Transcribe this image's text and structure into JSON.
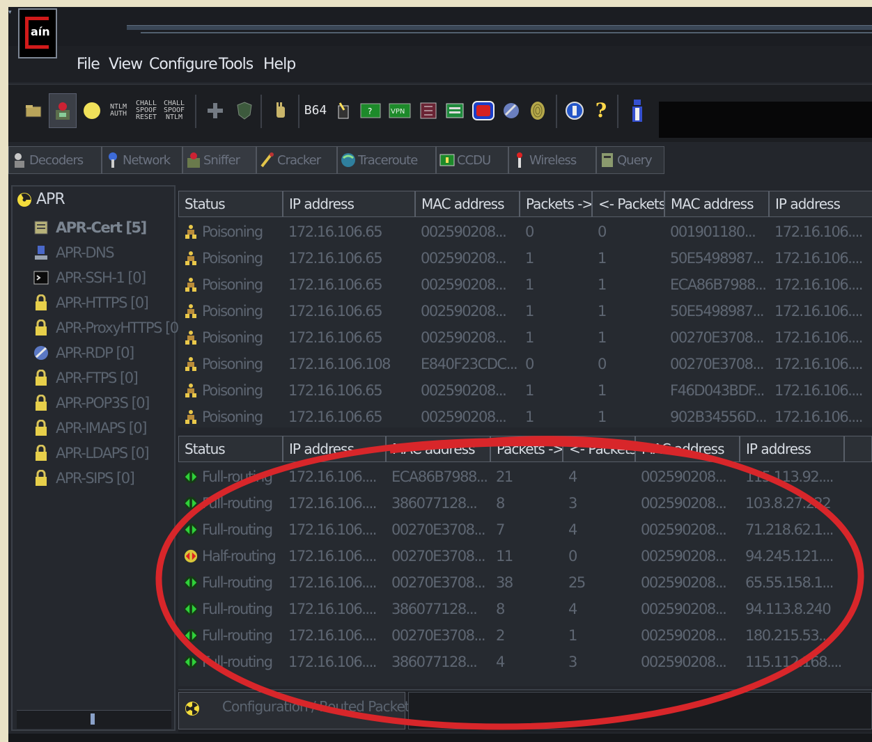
{
  "app": {
    "logo_text": "aín",
    "accent_red": "#d11a1a"
  },
  "menu": [
    "File",
    "View",
    "Configure",
    "Tools",
    "Help"
  ],
  "toolbar": {
    "buttons": [
      {
        "icon": "folder-icon"
      },
      {
        "icon": "sniffer-icon",
        "pressed": true
      },
      {
        "icon": "apr-radiation-icon"
      },
      {
        "icon": "ntlm-auth-icon",
        "label": "NTLM AUTH"
      },
      {
        "icon": "chall-spoof-reset-icon",
        "label": "CHALL SPOOF RESET"
      },
      {
        "icon": "chall-spoof-ntlm-icon",
        "label": "CHALL SPOOF NTLM"
      },
      {
        "icon": "plus-icon"
      },
      {
        "icon": "shield-icon"
      },
      {
        "icon": "hand-icon"
      },
      {
        "icon": "base64-icon",
        "label": "B64"
      },
      {
        "icon": "wand-icon"
      },
      {
        "icon": "terminal-icon"
      },
      {
        "icon": "vpn-icon",
        "label": "VPN"
      },
      {
        "icon": "grid-icon"
      },
      {
        "icon": "screen-icon"
      },
      {
        "icon": "tv-icon"
      },
      {
        "icon": "satellite-icon"
      },
      {
        "icon": "fingerprint-icon"
      },
      {
        "icon": "globe-icon"
      },
      {
        "icon": "help-question-icon",
        "label": "?"
      },
      {
        "icon": "info-icon"
      }
    ]
  },
  "tabs": [
    "Decoders",
    "Network",
    "Sniffer",
    "Cracker",
    "Traceroute",
    "CCDU",
    "Wireless",
    "Query"
  ],
  "sidebar": {
    "root": "APR",
    "items": [
      {
        "label": "APR-Cert [5]",
        "icon": "cert-icon",
        "bold": true
      },
      {
        "label": "APR-DNS",
        "icon": "dns-icon"
      },
      {
        "label": "APR-SSH-1 [0]",
        "icon": "ssh-icon"
      },
      {
        "label": "APR-HTTPS [0]",
        "icon": "lock-icon"
      },
      {
        "label": "APR-ProxyHTTPS [0",
        "icon": "lock-icon"
      },
      {
        "label": "APR-RDP [0]",
        "icon": "rdp-icon"
      },
      {
        "label": "APR-FTPS [0]",
        "icon": "lock-icon"
      },
      {
        "label": "APR-POP3S [0]",
        "icon": "lock-icon"
      },
      {
        "label": "APR-IMAPS [0]",
        "icon": "lock-icon"
      },
      {
        "label": "APR-LDAPS [0]",
        "icon": "lock-icon"
      },
      {
        "label": "APR-SIPS [0]",
        "icon": "lock-icon"
      }
    ]
  },
  "top_table": {
    "headers": [
      "Status",
      "IP address",
      "MAC address",
      "Packets ->",
      "<- Packets",
      "MAC address",
      "IP address"
    ],
    "rows": [
      [
        "Poisoning",
        "172.16.106.65",
        "002590208...",
        "0",
        "0",
        "001901180...",
        "172.16.106...."
      ],
      [
        "Poisoning",
        "172.16.106.65",
        "002590208...",
        "1",
        "1",
        "50E5498987...",
        "172.16.106...."
      ],
      [
        "Poisoning",
        "172.16.106.65",
        "002590208...",
        "1",
        "1",
        "ECA86B7988...",
        "172.16.106...."
      ],
      [
        "Poisoning",
        "172.16.106.65",
        "002590208...",
        "1",
        "1",
        "50E5498987...",
        "172.16.106...."
      ],
      [
        "Poisoning",
        "172.16.106.65",
        "002590208...",
        "1",
        "1",
        "00270E3708...",
        "172.16.106...."
      ],
      [
        "Poisoning",
        "172.16.106.108",
        "E840F23CDC...",
        "0",
        "0",
        "00270E3708...",
        "172.16.106...."
      ],
      [
        "Poisoning",
        "172.16.106.65",
        "002590208...",
        "1",
        "1",
        "F46D043BDF...",
        "172.16.106...."
      ],
      [
        "Poisoning",
        "172.16.106.65",
        "002590208...",
        "1",
        "1",
        "902B34556D...",
        "172.16.106...."
      ]
    ]
  },
  "bottom_table": {
    "headers": [
      "Status",
      "IP address",
      "MAC address",
      "Packets ->",
      "<- Packets",
      "MAC address",
      "IP address"
    ],
    "rows": [
      [
        "Full-routing",
        "172.16.106....",
        "ECA86B7988...",
        "21",
        "4",
        "002590208...",
        "115.113.92...."
      ],
      [
        "Full-routing",
        "172.16.106....",
        "386077128...",
        "8",
        "3",
        "002590208...",
        "103.8.27.222"
      ],
      [
        "Full-routing",
        "172.16.106....",
        "00270E3708...",
        "7",
        "4",
        "002590208...",
        "71.218.62.1..."
      ],
      [
        "Half-routing",
        "172.16.106....",
        "00270E3708...",
        "11",
        "0",
        "002590208...",
        "94.245.121...."
      ],
      [
        "Full-routing",
        "172.16.106....",
        "00270E3708...",
        "38",
        "25",
        "002590208...",
        "65.55.158.1..."
      ],
      [
        "Full-routing",
        "172.16.106....",
        "386077128...",
        "8",
        "4",
        "002590208...",
        "94.113.8.240"
      ],
      [
        "Full-routing",
        "172.16.106....",
        "00270E3708...",
        "2",
        "1",
        "002590208...",
        "180.215.53...."
      ],
      [
        "Full-routing",
        "172.16.106....",
        "386077128...",
        "4",
        "3",
        "002590208...",
        "115.112.168...."
      ]
    ]
  },
  "bottom_panel": {
    "tab_label": "Configuration / Routed Packets"
  },
  "annotation_color": "#d8262a"
}
